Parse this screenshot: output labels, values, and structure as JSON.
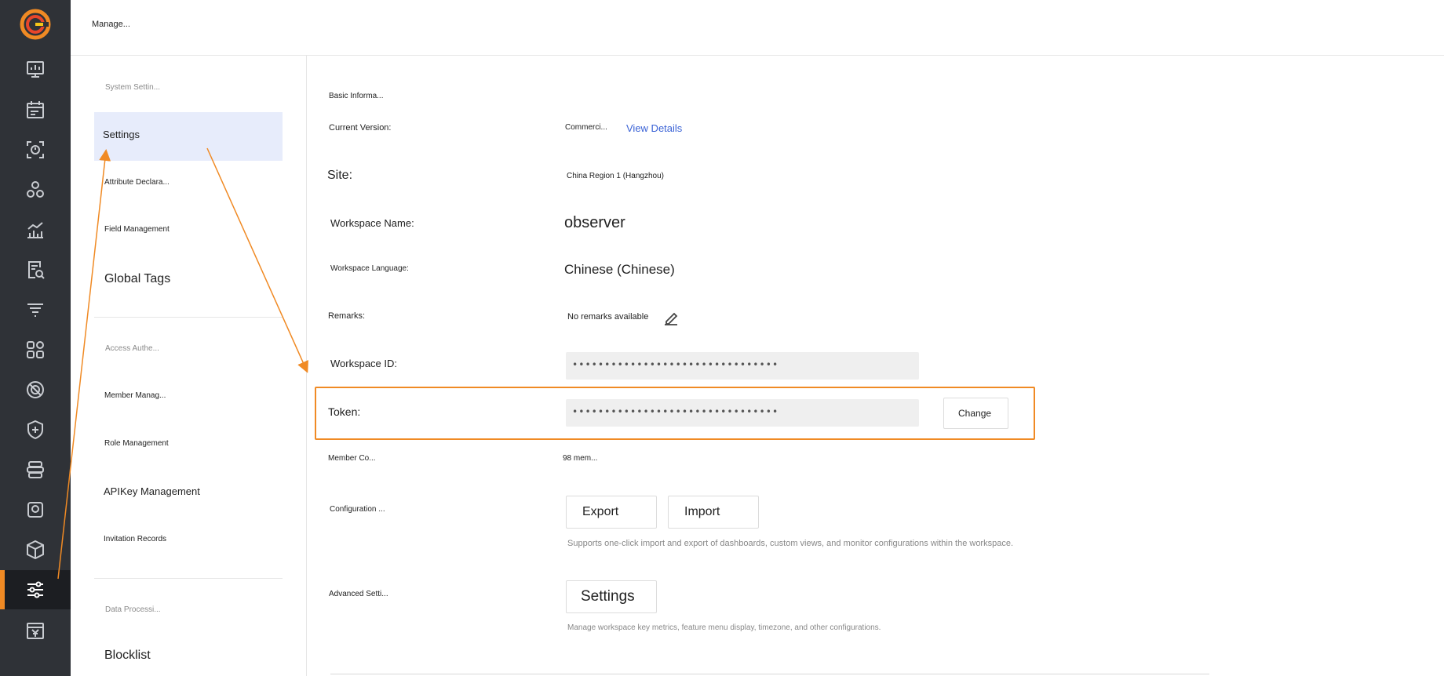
{
  "topbar": {
    "title": "Manage..."
  },
  "rail": {
    "items": [
      {
        "icon": "dashboard-icon"
      },
      {
        "icon": "calendar-icon"
      },
      {
        "icon": "scan-icon"
      },
      {
        "icon": "cluster-icon"
      },
      {
        "icon": "metrics-chart-icon"
      },
      {
        "icon": "log-search-icon"
      },
      {
        "icon": "filter-icon"
      },
      {
        "icon": "apps-icon"
      },
      {
        "icon": "monitor-gauge-icon"
      },
      {
        "icon": "security-shield-icon"
      },
      {
        "icon": "integration-stack-icon"
      },
      {
        "icon": "synthetic-monitor-icon"
      },
      {
        "icon": "cube-icon"
      },
      {
        "icon": "settings-sliders-icon"
      },
      {
        "icon": "billing-yen-icon"
      }
    ],
    "active_index": 13,
    "accent_color": "#f08a24"
  },
  "subnav": {
    "group1_title": "System Settin...",
    "settings": "Settings",
    "attribute": "Attribute Declara...",
    "field_management": "Field Management",
    "global_tags": "Global Tags",
    "group2_title": "Access Authe...",
    "member_management": "Member Manag...",
    "role_management": "Role Management",
    "apikey_management": "APIKey Management",
    "invitation_records": "Invitation Records",
    "group3_title": "Data Processi...",
    "blocklist": "Blocklist"
  },
  "main": {
    "section_title": "Basic Informa...",
    "current_version_label": "Current Version:",
    "current_version_value": "Commerci...",
    "view_details": "View Details",
    "site_label": "Site:",
    "site_value": "China Region 1 (Hangzhou)",
    "workspace_name_label": "Workspace Name:",
    "workspace_name_value": "observer",
    "workspace_language_label": "Workspace Language:",
    "workspace_language_value": "Chinese (Chinese)",
    "remarks_label": "Remarks:",
    "remarks_value": "No remarks available",
    "workspace_id_label": "Workspace ID:",
    "workspace_id_value": "••••••••••••••••••••••••••••••••",
    "token_label": "Token:",
    "token_value": "••••••••••••••••••••••••••••••••",
    "change_button": "Change",
    "member_count_label": "Member Co...",
    "member_count_value": "98 mem...",
    "configuration_label": "Configuration ...",
    "export_button": "Export",
    "import_button": "Import",
    "configuration_hint": "Supports one-click import and export of dashboards, custom views, and monitor configurations within the workspace.",
    "advanced_label": "Advanced Setti...",
    "advanced_settings_button": "Settings",
    "advanced_hint": "Manage workspace key metrics, feature menu display, timezone, and other configurations."
  },
  "colors": {
    "highlight": "#f08a24",
    "link": "#3b63d6",
    "active_nav_bg": "#e7ecfb"
  }
}
